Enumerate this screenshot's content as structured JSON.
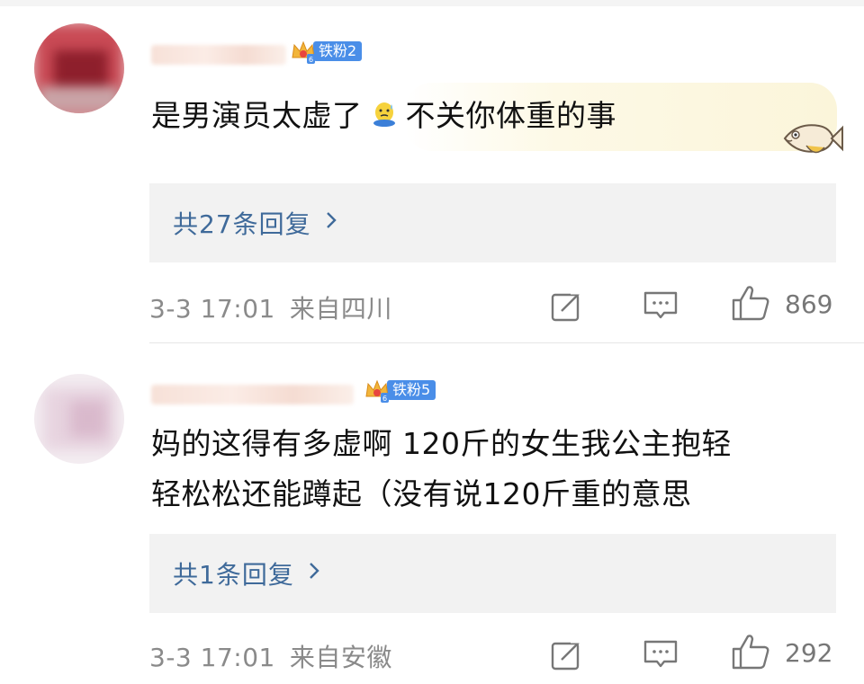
{
  "comments": [
    {
      "fan_badge": "铁粉2",
      "text_part1": "是男演员太虚了",
      "text_part2": "不关你体重的事",
      "reply_label": "共27条回复",
      "time": "3-3 17:01",
      "location": "来自四川",
      "likes": "869"
    },
    {
      "fan_badge": "铁粉5",
      "text_line1": "妈的这得有多虚啊 120斤的女生我公主抱轻",
      "text_line2": "轻松松还能蹲起（没有说120斤重的意思",
      "reply_label": "共1条回复",
      "time": "3-3 17:01",
      "location": "来自安徽",
      "likes": "292"
    }
  ],
  "icons": {
    "fan_badge": "crown-icon",
    "share": "repost-icon",
    "comment": "comment-icon",
    "like": "thumbs-up-icon",
    "reply_arrow": "chevron-right-icon",
    "inline_emoji": "sweat-emoji-icon",
    "decoration": "fish-sticker-icon"
  },
  "colors": {
    "badge_blue": "#4a8ee8",
    "reply_link": "#3f6a9a",
    "meta_gray": "#8a8a8a"
  }
}
